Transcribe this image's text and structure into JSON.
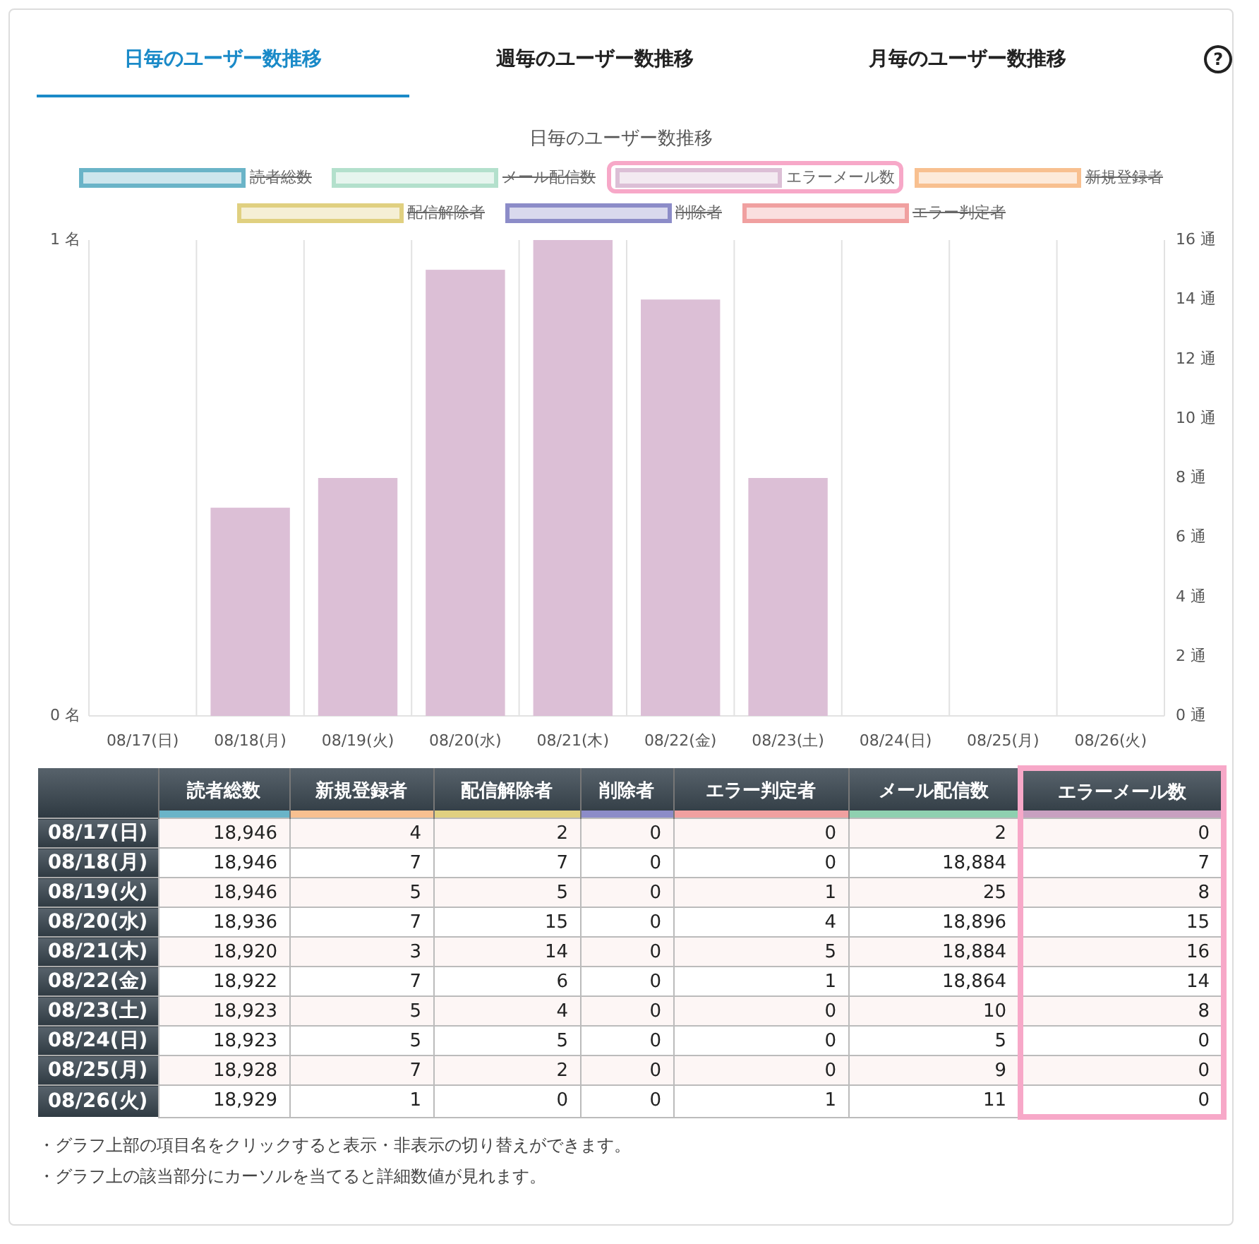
{
  "tabs": [
    {
      "label": "日毎のユーザー数推移",
      "selected": true
    },
    {
      "label": "週毎のユーザー数推移",
      "selected": false
    },
    {
      "label": "月毎のユーザー数推移",
      "selected": false
    }
  ],
  "help": "?",
  "chart": {
    "title": "日毎のユーザー数推移",
    "legend": [
      {
        "label": "読者総数",
        "color": "#6ab4c8",
        "hidden": true,
        "highlighted": false
      },
      {
        "label": "メール配信数",
        "color": "#b3e0cc",
        "hidden": true,
        "highlighted": false
      },
      {
        "label": "エラーメール数",
        "color": "#dcbfd6",
        "hidden": false,
        "highlighted": true
      },
      {
        "label": "新規登録者",
        "color": "#f8c090",
        "hidden": true,
        "highlighted": false
      },
      {
        "label": "配信解除者",
        "color": "#e0d080",
        "hidden": true,
        "highlighted": false
      },
      {
        "label": "削除者",
        "color": "#8c8cc8",
        "hidden": true,
        "highlighted": false
      },
      {
        "label": "エラー判定者",
        "color": "#f0a0a0",
        "hidden": true,
        "highlighted": false
      }
    ],
    "left_axis_labels": [
      "1 名",
      "0 名"
    ],
    "chart_data": {
      "type": "bar",
      "categories": [
        "08/17(日)",
        "08/18(月)",
        "08/19(火)",
        "08/20(水)",
        "08/21(木)",
        "08/22(金)",
        "08/23(土)",
        "08/24(日)",
        "08/25(月)",
        "08/26(火)"
      ],
      "series": [
        {
          "color": "#dcbfd6",
          "values": [
            0,
            7,
            8,
            15,
            16,
            14,
            8,
            0,
            0,
            0
          ]
        }
      ],
      "ylim": [
        0,
        16
      ],
      "yticks": [
        {
          "value": 0,
          "label": "0 通"
        },
        {
          "value": 2,
          "label": "2 通"
        },
        {
          "value": 4,
          "label": "4 通"
        },
        {
          "value": 6,
          "label": "6 通"
        },
        {
          "value": 8,
          "label": "8 通"
        },
        {
          "value": 10,
          "label": "10 通"
        },
        {
          "value": 12,
          "label": "12 通"
        },
        {
          "value": 14,
          "label": "14 通"
        },
        {
          "value": 16,
          "label": "16 通"
        }
      ]
    }
  },
  "table": {
    "columns": [
      {
        "label": "読者総数",
        "color": "#6ab4c8",
        "highlighted": false
      },
      {
        "label": "新規登録者",
        "color": "#f8c090",
        "highlighted": false
      },
      {
        "label": "配信解除者",
        "color": "#e0d080",
        "highlighted": false
      },
      {
        "label": "削除者",
        "color": "#8c8cc8",
        "highlighted": false
      },
      {
        "label": "エラー判定者",
        "color": "#f0a0a0",
        "highlighted": false
      },
      {
        "label": "メール配信数",
        "color": "#8fd0b0",
        "highlighted": false
      },
      {
        "label": "エラーメール数",
        "color": "#c8a0c0",
        "highlighted": true
      }
    ],
    "rows": [
      {
        "date": "08/17(日)",
        "values": [
          "18,946",
          "4",
          "2",
          "0",
          "0",
          "2",
          "0"
        ]
      },
      {
        "date": "08/18(月)",
        "values": [
          "18,946",
          "7",
          "7",
          "0",
          "0",
          "18,884",
          "7"
        ]
      },
      {
        "date": "08/19(火)",
        "values": [
          "18,946",
          "5",
          "5",
          "0",
          "1",
          "25",
          "8"
        ]
      },
      {
        "date": "08/20(水)",
        "values": [
          "18,936",
          "7",
          "15",
          "0",
          "4",
          "18,896",
          "15"
        ]
      },
      {
        "date": "08/21(木)",
        "values": [
          "18,920",
          "3",
          "14",
          "0",
          "5",
          "18,884",
          "16"
        ]
      },
      {
        "date": "08/22(金)",
        "values": [
          "18,922",
          "7",
          "6",
          "0",
          "1",
          "18,864",
          "14"
        ]
      },
      {
        "date": "08/23(土)",
        "values": [
          "18,923",
          "5",
          "4",
          "0",
          "0",
          "10",
          "8"
        ]
      },
      {
        "date": "08/24(日)",
        "values": [
          "18,923",
          "5",
          "5",
          "0",
          "0",
          "5",
          "0"
        ]
      },
      {
        "date": "08/25(月)",
        "values": [
          "18,928",
          "7",
          "2",
          "0",
          "0",
          "9",
          "0"
        ]
      },
      {
        "date": "08/26(火)",
        "values": [
          "18,929",
          "1",
          "0",
          "0",
          "1",
          "11",
          "0"
        ]
      }
    ]
  },
  "notes": [
    "・グラフ上部の項目名をクリックすると表示・非表示の切り替えができます。",
    "・グラフ上の該当部分にカーソルを当てると詳細数値が見れます。"
  ]
}
